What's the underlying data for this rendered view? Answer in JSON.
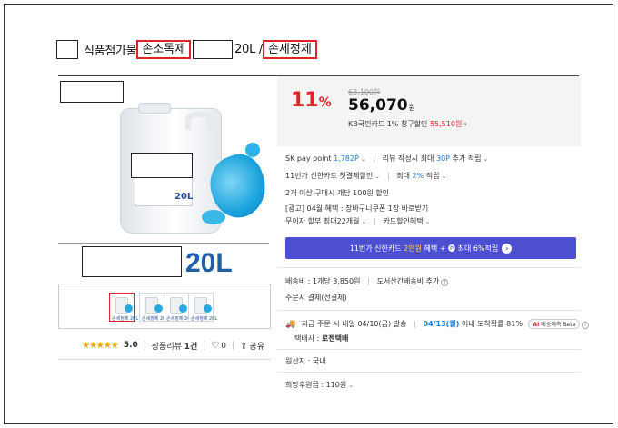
{
  "title": {
    "part1": "식품첨가물",
    "red1": "손소독제",
    "part2": "20L /",
    "red2": "손세정제"
  },
  "product_image": {
    "jug_size_label": "20L",
    "big_label": "20L"
  },
  "thumbnails": [
    {
      "label": "손세정제 20L"
    },
    {
      "label": "손세정제 20L"
    },
    {
      "label": "손세정제 20L"
    },
    {
      "label": "손세정제 20L"
    }
  ],
  "rating": {
    "stars": "★★★★★",
    "score": "5.0",
    "review_label": "상품리뷰",
    "review_count": "1건",
    "like_count": "0",
    "share_label": "공유"
  },
  "price": {
    "discount": "11",
    "discount_unit": "%",
    "original": "63,100원",
    "sale": "56,070",
    "sale_unit": "원",
    "card_text": "KB국민카드 1% 청구할인",
    "card_price": "55,510원",
    "card_chevron": "›"
  },
  "benefits": {
    "sk_label": "SK pay point",
    "sk_value": "1,782P",
    "review_label": "리뷰 작성시 최대",
    "review_points": "30P",
    "review_suffix": "추가 적립",
    "shinhan_label": "11번가 신한카드 첫결제할인",
    "max_label": "최대",
    "max_rate": "2%",
    "max_suffix": "적립",
    "multi_buy": "2개 이상 구매시 개당 100원 할인",
    "ad_label": "[광고] 04월 혜택 : 장바구니쿠폰 1장 바로받기",
    "installment": "무이자 할부 최대22개월",
    "card_benefit": "카드할인혜택"
  },
  "banner": {
    "prefix": "11번가 신한카드",
    "highlight": "2만원",
    "suffix": "혜택 + 🅟 최대 6%적립",
    "go": "›"
  },
  "shipping": {
    "fee": "배송비 : 1개당 3,850원",
    "extra": "도서산간배송비 추가",
    "order_type": "주문시 결제(선결제)",
    "arrival_prefix": "지금 주문 시 내일 04/10(금) 발송",
    "arrival_date": "04/13(월)",
    "arrival_suffix": "이내 도착확률 81%",
    "ai_prefix": "AI",
    "ai_text": "배송예측 Beta",
    "courier_label": "택배사 :",
    "courier": "로젠택배",
    "origin": "원산지 : 국내",
    "deposit": "희망후원금 : 110원"
  },
  "colors": {
    "accent_red": "#e0222b",
    "banner_purple": "#4d4fd1",
    "link_blue": "#1e78d2",
    "star_gold": "#f5a300"
  }
}
